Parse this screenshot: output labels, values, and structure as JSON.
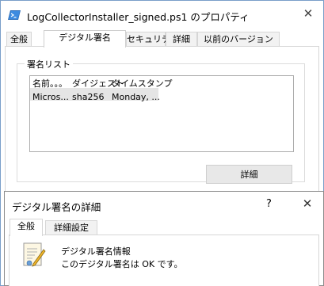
{
  "properties_window": {
    "title": "LogCollectorInstaller_signed.ps1 のプロパティ",
    "tabs": [
      "全般",
      "デジタル署名",
      "セキュリティ",
      "詳細",
      "以前のバージョン"
    ],
    "active_tab": "デジタル署名",
    "signature_list": {
      "group_label": "署名リスト",
      "columns": [
        "名前。。。",
        "ダイジェスト",
        "タイムスタンプ"
      ],
      "rows": [
        {
          "name": "Micros...",
          "digest": "sha256",
          "timestamp": "Monday, ..."
        }
      ]
    },
    "details_button": "詳細"
  },
  "signature_details_dialog": {
    "title": "デジタル署名の詳細",
    "help": "?",
    "tabs": [
      "全般",
      "詳細設定"
    ],
    "active_tab": "全般",
    "info_heading": "デジタル署名情報",
    "info_status": "このデジタル署名は OK です。"
  },
  "icons": {
    "file": "powershell-script-icon",
    "certificate": "certificate-document-icon",
    "close": "close-icon"
  },
  "colors": {
    "window_border": "#7a9ec9",
    "selected_row": "#e5e5e5",
    "button_bg": "#e8e8e8"
  }
}
